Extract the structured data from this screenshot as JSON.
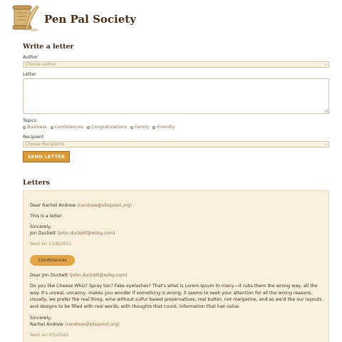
{
  "header": {
    "title": "Pen Pal Society",
    "logo_icon": "scroll-quill-icon"
  },
  "form": {
    "title": "Write a letter",
    "author_label": "Author",
    "author_placeholder": "Choose author",
    "letter_label": "Letter",
    "letter_value": "",
    "topics_label": "Topics",
    "topics": [
      "Business",
      "Condolences",
      "Congratulations",
      "Family",
      "Friendly"
    ],
    "recipient_label": "Recipient",
    "recipient_placeholder": "Choose Recipients",
    "send_label": "SEND LETTER"
  },
  "letters": {
    "title": "Letters",
    "items": [
      {
        "greeting": "Dear Rachel Andrew",
        "to_email": "(randrew@sitepoint.org)",
        "body": "This is a letter.",
        "closing": "Sincerely,",
        "from_name": "Jon Duckett",
        "from_email": "(john.duckett@wiley.com)",
        "sent": "Sent on 11/8/2021"
      },
      {
        "tag": "Condolences",
        "greeting": "Dear Jon Duckett",
        "to_email": "(john.duckett@wiley.com)",
        "body": "Do you like Cheese Whiz? Spray tan? Fake eyelashes? That's what is Lorem Ipsum to many—it rubs them the wrong way, all the way. It's unreal, uncanny, makes you wonder if something is wrong, it seems to seek your attention for all the wrong reasons. Usually, we prefer the real thing, wine without sulfur based preservatives, real butter, not margarine, and so we'd like our layouts and designs to be filled with real words, with thoughts that count, information that has value.",
        "closing": "Sincerely,",
        "from_name": "Rachel Andrew",
        "from_email": "(randrew@sitepoint.org)",
        "sent": "Sent on 5/5/2022"
      }
    ]
  },
  "colors": {
    "accent": "#d99a33",
    "panel": "#fbf0dd",
    "text": "#3e2a17"
  }
}
